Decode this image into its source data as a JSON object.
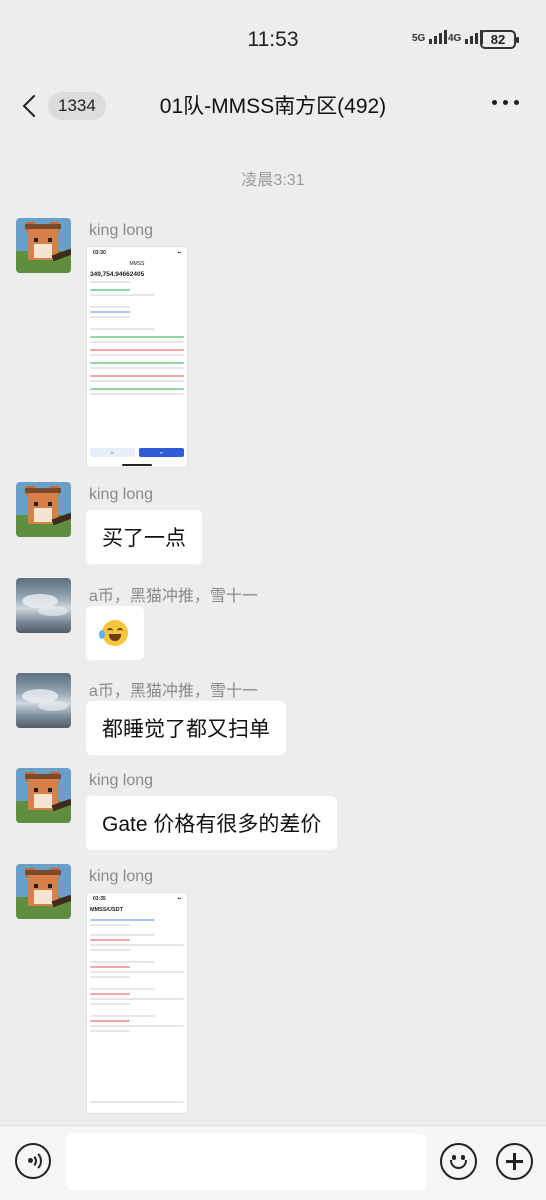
{
  "status_bar": {
    "time": "11:53",
    "signal1_label": "5G",
    "signal2_label": "4G",
    "battery": "82"
  },
  "nav": {
    "unread_count": "1334",
    "title": "01队-MMSS南方区(492)"
  },
  "chat": {
    "timestamp": "凌晨3:31",
    "messages": [
      {
        "sender": "king long",
        "type": "image",
        "avatar": "pixel-dog-avatar"
      },
      {
        "sender": "king long",
        "type": "text",
        "text": "买了一点",
        "avatar": "pixel-dog-avatar"
      },
      {
        "sender": "a币，黑猫冲推，雪十一",
        "type": "emoji",
        "emoji": "laughing-tears-emoji",
        "avatar": "cloudy-sky-avatar"
      },
      {
        "sender": "a币，黑猫冲推，雪十一",
        "type": "text",
        "text": "都睡觉了都又扫单",
        "avatar": "cloudy-sky-avatar"
      },
      {
        "sender": "king long",
        "type": "text",
        "text": "Gate 价格有很多的差价",
        "avatar": "pixel-dog-avatar"
      },
      {
        "sender": "king long",
        "type": "image",
        "avatar": "pixel-dog-avatar"
      }
    ]
  },
  "screenshot1": {
    "time": "03:30",
    "header": "MMSS",
    "amount": "349,754.94662405"
  },
  "screenshot2": {
    "time": "03:35",
    "header": "MMSS/USDT"
  },
  "colors": {
    "background": "#ededed",
    "bubble": "#ffffff",
    "accent_blue": "#2e5bd8"
  }
}
